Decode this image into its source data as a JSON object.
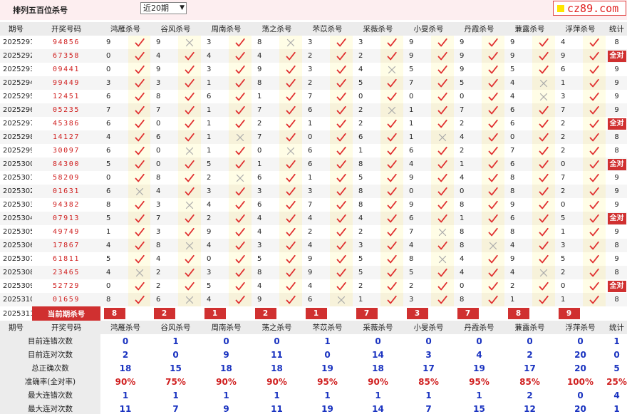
{
  "header": {
    "title": "排列五百位杀号",
    "select_value": "近20期",
    "brand": "cz89.com"
  },
  "columns": [
    "期号",
    "开奖号码",
    "鸿雁杀号",
    "谷风杀号",
    "周南杀号",
    "荡之杀号",
    "芣苡杀号",
    "采薇杀号",
    "小旻杀号",
    "丹霞杀号",
    "蒹露杀号",
    "浮萍杀号",
    "统计"
  ],
  "rows": [
    {
      "p": "2025291",
      "d": "94856",
      "k": [
        9,
        9,
        3,
        8,
        3,
        3,
        9,
        9,
        9,
        4
      ],
      "r": [
        1,
        0,
        1,
        0,
        1,
        1,
        1,
        1,
        1,
        1
      ],
      "s": "8"
    },
    {
      "p": "2025292",
      "d": "67358",
      "k": [
        0,
        4,
        4,
        4,
        2,
        2,
        9,
        9,
        9,
        9
      ],
      "r": [
        1,
        1,
        1,
        1,
        1,
        1,
        1,
        1,
        1,
        1
      ],
      "s": "全对"
    },
    {
      "p": "2025293",
      "d": "09441",
      "k": [
        0,
        9,
        3,
        9,
        3,
        4,
        5,
        9,
        5,
        6
      ],
      "r": [
        1,
        1,
        1,
        1,
        1,
        0,
        1,
        1,
        1,
        1
      ],
      "s": "9"
    },
    {
      "p": "2025294",
      "d": "99449",
      "k": [
        3,
        3,
        1,
        8,
        2,
        5,
        7,
        5,
        4,
        1
      ],
      "r": [
        1,
        1,
        1,
        1,
        1,
        1,
        1,
        1,
        0,
        1
      ],
      "s": "9"
    },
    {
      "p": "2025295",
      "d": "12451",
      "k": [
        6,
        8,
        6,
        1,
        7,
        0,
        0,
        0,
        4,
        3
      ],
      "r": [
        1,
        1,
        1,
        1,
        1,
        1,
        1,
        1,
        0,
        1
      ],
      "s": "9"
    },
    {
      "p": "2025296",
      "d": "05235",
      "k": [
        7,
        7,
        1,
        7,
        6,
        2,
        1,
        7,
        6,
        7
      ],
      "r": [
        1,
        1,
        1,
        1,
        1,
        0,
        1,
        1,
        1,
        1
      ],
      "s": "9"
    },
    {
      "p": "2025297",
      "d": "45386",
      "k": [
        6,
        0,
        1,
        2,
        1,
        2,
        1,
        2,
        6,
        2
      ],
      "r": [
        1,
        1,
        1,
        1,
        1,
        1,
        1,
        1,
        1,
        1
      ],
      "s": "全对"
    },
    {
      "p": "2025298",
      "d": "14127",
      "k": [
        4,
        6,
        1,
        7,
        0,
        6,
        1,
        4,
        0,
        2
      ],
      "r": [
        1,
        1,
        0,
        1,
        1,
        1,
        0,
        1,
        1,
        1
      ],
      "s": "8"
    },
    {
      "p": "2025299",
      "d": "30097",
      "k": [
        6,
        0,
        1,
        0,
        6,
        1,
        6,
        2,
        7,
        2
      ],
      "r": [
        1,
        0,
        1,
        0,
        1,
        1,
        1,
        1,
        1,
        1
      ],
      "s": "8"
    },
    {
      "p": "2025300",
      "d": "84300",
      "k": [
        5,
        0,
        5,
        1,
        6,
        8,
        4,
        1,
        6,
        0
      ],
      "r": [
        1,
        1,
        1,
        1,
        1,
        1,
        1,
        1,
        1,
        1
      ],
      "s": "全对"
    },
    {
      "p": "2025301",
      "d": "58209",
      "k": [
        0,
        8,
        2,
        6,
        1,
        5,
        9,
        4,
        8,
        7
      ],
      "r": [
        1,
        1,
        0,
        1,
        1,
        1,
        1,
        1,
        1,
        1
      ],
      "s": "9"
    },
    {
      "p": "2025302",
      "d": "01631",
      "k": [
        6,
        4,
        3,
        3,
        3,
        8,
        0,
        0,
        8,
        2
      ],
      "r": [
        0,
        1,
        1,
        1,
        1,
        1,
        1,
        1,
        1,
        1
      ],
      "s": "9"
    },
    {
      "p": "2025303",
      "d": "94382",
      "k": [
        8,
        3,
        4,
        6,
        7,
        8,
        9,
        8,
        9,
        0
      ],
      "r": [
        1,
        0,
        1,
        1,
        1,
        1,
        1,
        1,
        1,
        1
      ],
      "s": "9"
    },
    {
      "p": "2025304",
      "d": "07913",
      "k": [
        5,
        7,
        2,
        4,
        4,
        4,
        6,
        1,
        6,
        5
      ],
      "r": [
        1,
        1,
        1,
        1,
        1,
        1,
        1,
        1,
        1,
        1
      ],
      "s": "全对"
    },
    {
      "p": "2025305",
      "d": "49749",
      "k": [
        1,
        3,
        9,
        4,
        2,
        2,
        7,
        8,
        8,
        1
      ],
      "r": [
        1,
        1,
        1,
        1,
        1,
        1,
        0,
        1,
        1,
        1
      ],
      "s": "9"
    },
    {
      "p": "2025306",
      "d": "17867",
      "k": [
        4,
        8,
        4,
        3,
        4,
        3,
        4,
        8,
        4,
        3
      ],
      "r": [
        1,
        0,
        1,
        1,
        1,
        1,
        1,
        0,
        1,
        1
      ],
      "s": "8"
    },
    {
      "p": "2025307",
      "d": "61811",
      "k": [
        5,
        4,
        0,
        5,
        9,
        5,
        8,
        4,
        9,
        5
      ],
      "r": [
        1,
        1,
        1,
        1,
        1,
        1,
        0,
        1,
        1,
        1
      ],
      "s": "9"
    },
    {
      "p": "2025308",
      "d": "23465",
      "k": [
        4,
        2,
        3,
        8,
        9,
        5,
        5,
        4,
        4,
        2
      ],
      "r": [
        0,
        1,
        1,
        1,
        1,
        1,
        1,
        1,
        0,
        1
      ],
      "s": "8"
    },
    {
      "p": "2025309",
      "d": "52729",
      "k": [
        0,
        2,
        5,
        4,
        4,
        2,
        2,
        0,
        2,
        0
      ],
      "r": [
        1,
        1,
        1,
        1,
        1,
        1,
        1,
        1,
        1,
        1
      ],
      "s": "全对"
    },
    {
      "p": "2025310",
      "d": "01659",
      "k": [
        8,
        6,
        4,
        9,
        6,
        1,
        3,
        8,
        1,
        1
      ],
      "r": [
        1,
        0,
        1,
        1,
        0,
        1,
        1,
        1,
        1,
        1
      ],
      "s": "8"
    }
  ],
  "current": {
    "p": "2025311",
    "label": "当前期杀号",
    "k": [
      "8",
      "2",
      "1",
      "2",
      "1",
      "7",
      "3",
      "7",
      "8",
      "9"
    ]
  },
  "stats": [
    {
      "label": "目前连错次数",
      "v": [
        "0",
        "1",
        "0",
        "0",
        "1",
        "0",
        "0",
        "0",
        "0",
        "0",
        "1"
      ],
      "red": false
    },
    {
      "label": "目前连对次数",
      "v": [
        "2",
        "0",
        "9",
        "11",
        "0",
        "14",
        "3",
        "4",
        "2",
        "20",
        "0"
      ],
      "red": false
    },
    {
      "label": "总正确次数",
      "v": [
        "18",
        "15",
        "18",
        "18",
        "19",
        "18",
        "17",
        "19",
        "17",
        "20",
        "5"
      ],
      "red": false
    },
    {
      "label": "准确率(全对率)",
      "v": [
        "90%",
        "75%",
        "90%",
        "90%",
        "95%",
        "90%",
        "85%",
        "95%",
        "85%",
        "100%",
        "25%"
      ],
      "red": true
    },
    {
      "label": "最大连错次数",
      "v": [
        "1",
        "1",
        "1",
        "1",
        "1",
        "1",
        "1",
        "1",
        "2",
        "0",
        "4"
      ],
      "red": false
    },
    {
      "label": "最大连对次数",
      "v": [
        "11",
        "7",
        "9",
        "11",
        "19",
        "14",
        "7",
        "15",
        "12",
        "20",
        "1"
      ],
      "red": false
    }
  ],
  "colors": {
    "accent": "#d03030",
    "stat_blue": "#1a33c0",
    "check": "#e03030",
    "cross": "#aaaaaa"
  }
}
